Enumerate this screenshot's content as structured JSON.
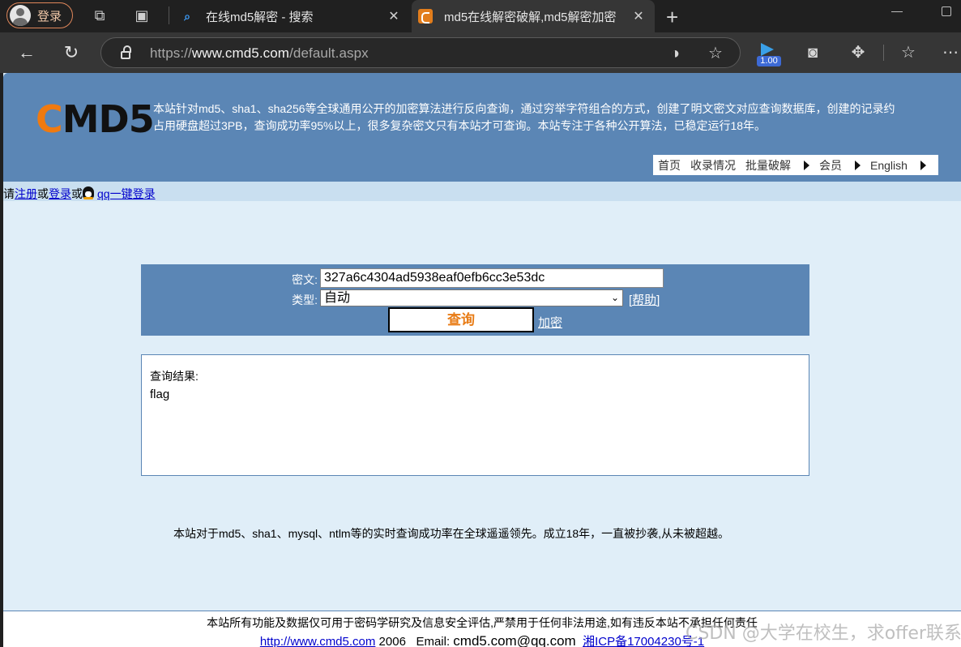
{
  "browser": {
    "profile_label": "登录",
    "tabs": [
      {
        "title": "在线md5解密 - 搜索",
        "icon": "search-icon"
      },
      {
        "title": "md5在线解密破解,md5解密加密",
        "icon": "cmd5-favicon"
      }
    ],
    "url_prefix": "https://",
    "url_host": "www.cmd5.com",
    "url_path": "/default.aspx",
    "zoom_level": "1.00"
  },
  "site": {
    "logo_c": "C",
    "logo_rest": "MD5",
    "intro_line1": "本站针对md5、sha1、sha256等全球通用公开的加密算法进行反向查询，通过穷举字符组合的方式，创建了明文密文对应查询数据库，创建的记录约",
    "intro_line2": "占用硬盘超过3PB，查询成功率95%以上，很多复杂密文只有本站才可查询。本站专注于各种公开算法，已稳定运行18年。",
    "nav": [
      "首页",
      "收录情况",
      "批量破解",
      "会员",
      "English"
    ],
    "login": {
      "prefix": "请",
      "register": "注册",
      "or1": "或",
      "login": "登录",
      "or2": "或",
      "qq_login": "qq一键登录"
    }
  },
  "form": {
    "cipher_label": "密文:",
    "cipher_value": "327a6c4304ad5938eaf0efb6cc3e53dc",
    "type_label": "类型:",
    "type_value": "自动",
    "help_label": "[帮助]",
    "query_button": "查询",
    "encrypt_link": "加密"
  },
  "result": {
    "title": "查询结果:",
    "value": "flag"
  },
  "claim": "本站对于md5、sha1、mysql、ntlm等的实时查询成功率在全球遥遥领先。成立18年，一直被抄袭,从未被超越。",
  "footer": {
    "line1": "本站所有功能及数据仅可用于密码学研究及信息安全评估,严禁用于任何非法用途,如有违反本站不承担任何责任",
    "site_link": "http://www.cmd5.com",
    "year": "2006",
    "email_label": "Email:",
    "email": "cmd5.com@qq.com",
    "icp": "湘ICP备17004230号-1"
  },
  "watermark": "CSDN @大学在校生，求offer联系",
  "colors": {
    "header_blue": "#5b86b5",
    "page_bg": "#e0eef8",
    "logo_orange": "#f07a10",
    "button_text": "#e87c16"
  }
}
